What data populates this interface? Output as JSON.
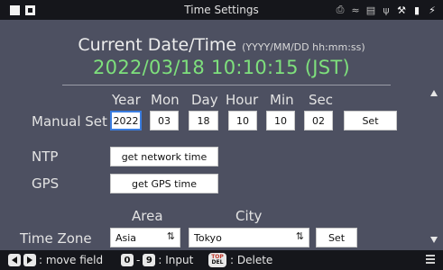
{
  "window": {
    "title": "Time Settings"
  },
  "status_icons": [
    "printer-icon",
    "wifi-icon",
    "network-icon",
    "usb-icon",
    "wrench-icon",
    "sd-card-icon",
    "power-plug-icon"
  ],
  "current": {
    "label": "Current Date/Time",
    "format": "(YYYY/MM/DD hh:mm:ss)",
    "value": "2022/03/18 10:10:15 (JST)",
    "value_color": "#7ee07c"
  },
  "columns": {
    "year": "Year",
    "mon": "Mon",
    "day": "Day",
    "hour": "Hour",
    "min": "Min",
    "sec": "Sec"
  },
  "manual": {
    "label": "Manual Set",
    "year": "2022",
    "mon": "03",
    "day": "18",
    "hour": "10",
    "min": "10",
    "sec": "02",
    "set_label": "Set"
  },
  "ntp": {
    "label": "NTP",
    "button": "get network time"
  },
  "gps": {
    "label": "GPS",
    "button": "get GPS time"
  },
  "timezone": {
    "label": "Time Zone",
    "area_header": "Area",
    "city_header": "City",
    "area_value": "Asia",
    "city_value": "Tokyo",
    "set_label": "Set"
  },
  "hints": {
    "move": ": move field",
    "key_0": "0",
    "key_9": "9",
    "input": ": Input",
    "top": "TOP",
    "del": "DEL",
    "delete": ": Delete"
  },
  "colors": {
    "background": "#4d5061",
    "bar": "#15161b",
    "selection": "#3a7de0"
  }
}
